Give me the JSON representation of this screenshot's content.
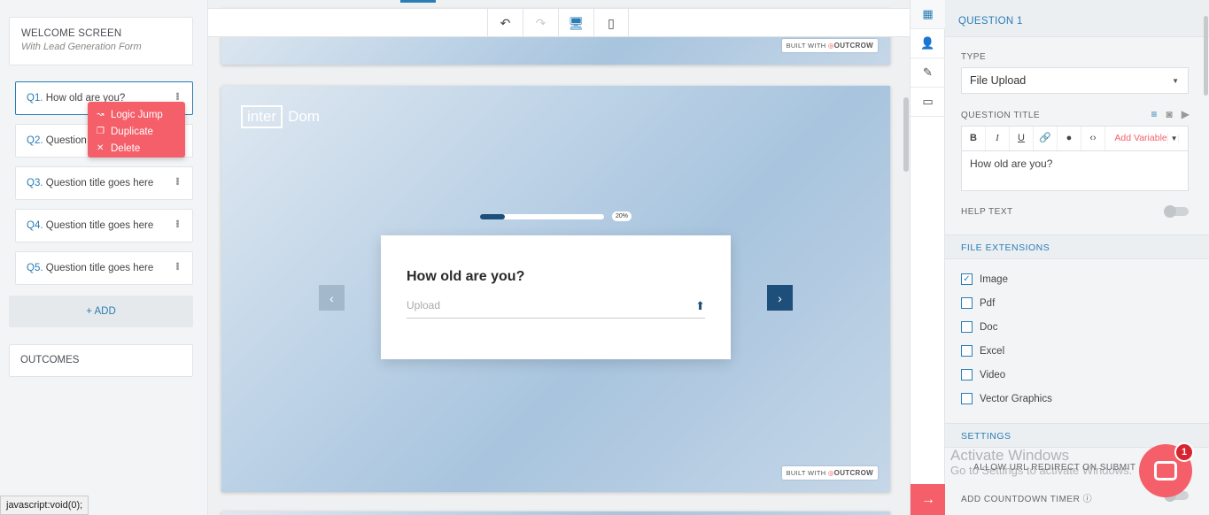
{
  "left": {
    "welcome_title": "WELCOME SCREEN",
    "welcome_subtitle": "With Lead Generation Form",
    "questions": [
      {
        "num": "Q1.",
        "title": "How old are you?"
      },
      {
        "num": "Q2.",
        "title": "Question"
      },
      {
        "num": "Q3.",
        "title": "Question title goes here"
      },
      {
        "num": "Q4.",
        "title": "Question title goes here"
      },
      {
        "num": "Q5.",
        "title": "Question title goes here"
      }
    ],
    "add_label": "+ ADD",
    "outcomes_label": "OUTCOMES",
    "context_menu": {
      "logic_jump": "Logic Jump",
      "duplicate": "Duplicate",
      "delete": "Delete"
    },
    "status_text": "javascript:void(0);"
  },
  "canvas": {
    "built_with": "BUILT WITH",
    "brand": "OUTCROW",
    "logo_box": "inter",
    "logo_text": "Dom",
    "progress_label": "20%",
    "progress_fraction": 0.2,
    "question": "How old are you?",
    "upload_placeholder": "Upload"
  },
  "right": {
    "header": "QUESTION 1",
    "type_label": "TYPE",
    "type_value": "File Upload",
    "title_label": "QUESTION TITLE",
    "editor_buttons": {
      "bold": "B",
      "italic": "I",
      "underline": "U",
      "add_variable": "Add Variable"
    },
    "title_value": "How old are you?",
    "help_text_label": "HELP TEXT",
    "file_ext_header": "FILE EXTENSIONS",
    "extensions": [
      {
        "label": "Image",
        "checked": true
      },
      {
        "label": "Pdf",
        "checked": false
      },
      {
        "label": "Doc",
        "checked": false
      },
      {
        "label": "Excel",
        "checked": false
      },
      {
        "label": "Video",
        "checked": false
      },
      {
        "label": "Vector Graphics",
        "checked": false
      }
    ],
    "settings_header": "SETTINGS",
    "allow_redirect": "ALLOW URL REDIRECT ON SUBMIT",
    "countdown": "ADD COUNTDOWN TIMER",
    "watermark_1": "Activate Windows",
    "watermark_2": "Go to Settings to activate Windows."
  },
  "chat_badge": "1",
  "colors": {
    "accent": "#2a7db5",
    "danger": "#f55f6a",
    "navy": "#1e4f7a"
  }
}
